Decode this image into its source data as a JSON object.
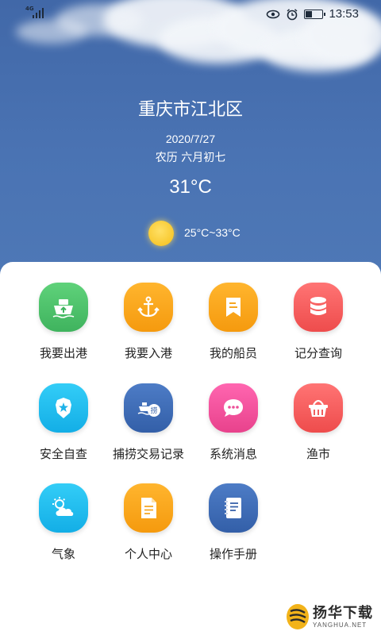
{
  "status_bar": {
    "network": "4G",
    "icons": [
      "eye-icon",
      "alarm-icon",
      "battery-icon"
    ],
    "time": "13:53"
  },
  "weather": {
    "location": "重庆市江北区",
    "date": "2020/7/27",
    "lunar_date": "农历 六月初七",
    "temperature": "31°C",
    "range": "25°C~33°C",
    "condition_icon": "sun-icon"
  },
  "menu": [
    {
      "label": "我要出港",
      "icon": "ship-icon",
      "color": "#4cc26a"
    },
    {
      "label": "我要入港",
      "icon": "anchor-icon",
      "color": "#fba21a"
    },
    {
      "label": "我的船员",
      "icon": "bookmark-icon",
      "color": "#fba21a"
    },
    {
      "label": "记分查询",
      "icon": "database-icon",
      "color": "#f35f5f"
    },
    {
      "label": "安全自查",
      "icon": "badge-icon",
      "color": "#1fbdf0"
    },
    {
      "label": "捕捞交易记录",
      "icon": "fishing-trade-icon",
      "color": "#3f6fb8"
    },
    {
      "label": "系统消息",
      "icon": "chat-bubble-icon",
      "color": "#ef4f98"
    },
    {
      "label": "渔市",
      "icon": "basket-icon",
      "color": "#f35f5f"
    },
    {
      "label": "气象",
      "icon": "weather-icon",
      "color": "#1fbdf0"
    },
    {
      "label": "个人中心",
      "icon": "document-icon",
      "color": "#fba21a"
    },
    {
      "label": "操作手册",
      "icon": "notebook-icon",
      "color": "#3f6fb8"
    }
  ],
  "watermark": {
    "name": "扬华下载",
    "domain": "YANGHUA.NET"
  }
}
